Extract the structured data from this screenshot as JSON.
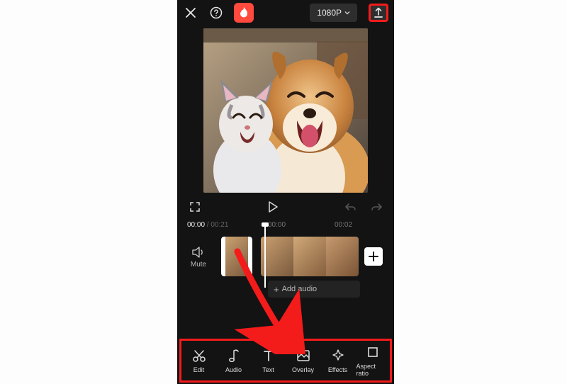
{
  "topbar": {
    "resolution_label": "1080P"
  },
  "transport": {
    "current_time": "00:00",
    "total_time": "00:21"
  },
  "ruler": {
    "ticks": [
      "00:00",
      "00:02"
    ]
  },
  "mute": {
    "label": "Mute"
  },
  "add_audio": {
    "label": "Add audio"
  },
  "toolbar": {
    "items": [
      {
        "label": "Edit"
      },
      {
        "label": "Audio"
      },
      {
        "label": "Text"
      },
      {
        "label": "Overlay"
      },
      {
        "label": "Effects"
      },
      {
        "label": "Aspect ratio"
      }
    ]
  }
}
